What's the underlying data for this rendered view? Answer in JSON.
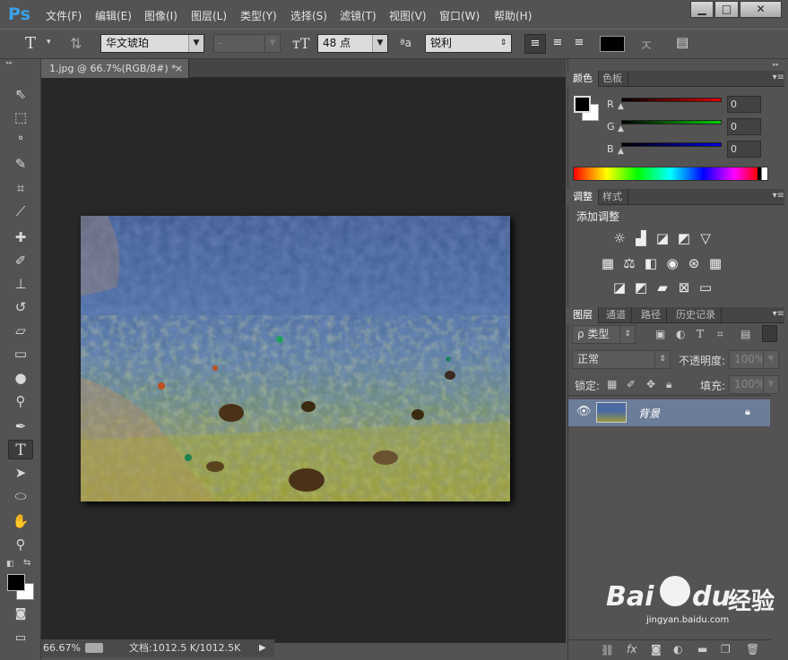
{
  "app": {
    "logo": "Ps"
  },
  "menu": [
    "文件(F)",
    "编辑(E)",
    "图像(I)",
    "图层(L)",
    "类型(Y)",
    "选择(S)",
    "滤镜(T)",
    "视图(V)",
    "窗口(W)",
    "帮助(H)"
  ],
  "window_controls": {
    "minimize": "▁",
    "maximize": "□",
    "close": "✕"
  },
  "options": {
    "tool_glyph": "T",
    "font_family": "华文琥珀",
    "font_style": "-",
    "font_size": "48 点",
    "aa_label": "ªa",
    "antialias": "锐利",
    "text_color": "#000000"
  },
  "document": {
    "tab_title": "1.jpg @ 66.7%(RGB/8#) *",
    "tab_close": "×",
    "zoom": "66.67%",
    "doc_info": "文档:1012.5 K/1012.5K"
  },
  "color_panel": {
    "tabs": [
      "颜色",
      "色板"
    ],
    "channels": [
      {
        "label": "R",
        "value": "0",
        "color": "#e00000"
      },
      {
        "label": "G",
        "value": "0",
        "color": "#00d000"
      },
      {
        "label": "B",
        "value": "0",
        "color": "#0000e0"
      }
    ],
    "foreground": "#000000",
    "background": "#ffffff"
  },
  "adjustments_panel": {
    "tabs": [
      "调整",
      "样式"
    ],
    "title": "添加调整"
  },
  "layers_panel": {
    "tabs": [
      "图层",
      "通道",
      "路径",
      "历史记录"
    ],
    "filter_kind": "ρ 类型",
    "blend_mode": "正常",
    "opacity_label": "不透明度:",
    "opacity_value": "100%",
    "lock_label": "锁定:",
    "fill_label": "填充:",
    "fill_value": "100%",
    "layers": [
      {
        "name": "背景",
        "visible": true,
        "locked": true
      }
    ]
  },
  "watermark": {
    "brand": "Bai",
    "brand2": "du",
    "text": "经验",
    "url": "jingyan.baidu.com"
  }
}
